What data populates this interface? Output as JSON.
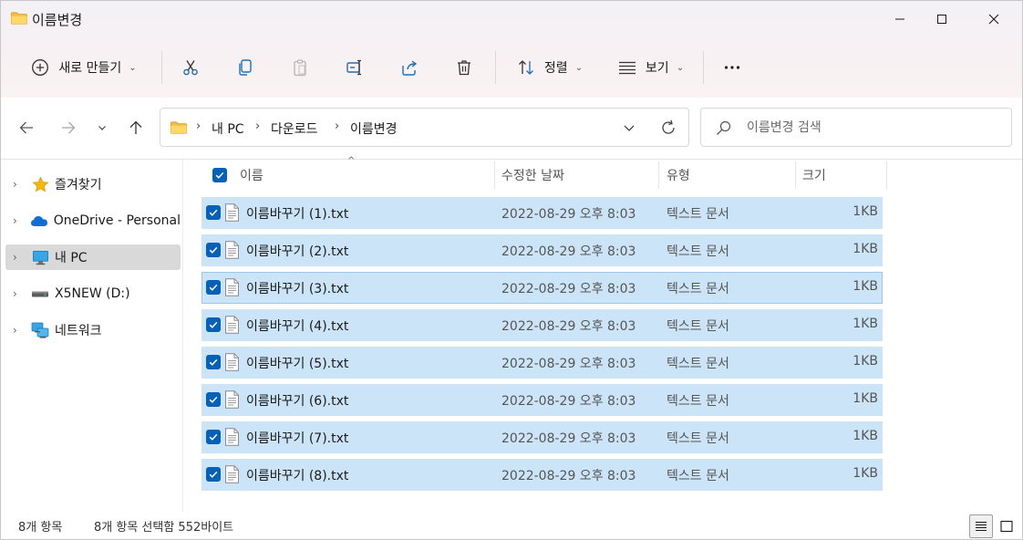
{
  "window": {
    "title": "이름변경",
    "controls": [
      "minimize",
      "maximize",
      "close"
    ]
  },
  "toolbar": {
    "new_label": "새로 만들기",
    "sort_label": "정렬",
    "view_label": "보기",
    "icons": [
      "cut-icon",
      "copy-icon",
      "paste-icon",
      "rename-icon",
      "share-icon",
      "delete-icon",
      "more-icon"
    ]
  },
  "nav": {
    "breadcrumbs": [
      "내 PC",
      "다운로드",
      "이름변경"
    ],
    "search_placeholder": "이름변경 검색"
  },
  "sidebar": {
    "items": [
      {
        "label": "즐겨찾기",
        "icon": "star-icon",
        "selected": false
      },
      {
        "label": "OneDrive - Personal",
        "icon": "cloud-icon",
        "selected": false
      },
      {
        "label": "내 PC",
        "icon": "computer-icon",
        "selected": true
      },
      {
        "label": "X5NEW (D:)",
        "icon": "drive-icon",
        "selected": false
      },
      {
        "label": "네트워크",
        "icon": "network-icon",
        "selected": false
      }
    ]
  },
  "columns": {
    "name": "이름",
    "date": "수정한 날짜",
    "type": "유형",
    "size": "크기"
  },
  "files": [
    {
      "name": "이름바꾸기 (1).txt",
      "date": "2022-08-29 오후 8:03",
      "type": "텍스트 문서",
      "size": "1KB",
      "checked": true
    },
    {
      "name": "이름바꾸기 (2).txt",
      "date": "2022-08-29 오후 8:03",
      "type": "텍스트 문서",
      "size": "1KB",
      "checked": true
    },
    {
      "name": "이름바꾸기 (3).txt",
      "date": "2022-08-29 오후 8:03",
      "type": "텍스트 문서",
      "size": "1KB",
      "checked": true
    },
    {
      "name": "이름바꾸기 (4).txt",
      "date": "2022-08-29 오후 8:03",
      "type": "텍스트 문서",
      "size": "1KB",
      "checked": true
    },
    {
      "name": "이름바꾸기 (5).txt",
      "date": "2022-08-29 오후 8:03",
      "type": "텍스트 문서",
      "size": "1KB",
      "checked": true
    },
    {
      "name": "이름바꾸기 (6).txt",
      "date": "2022-08-29 오후 8:03",
      "type": "텍스트 문서",
      "size": "1KB",
      "checked": true
    },
    {
      "name": "이름바꾸기 (7).txt",
      "date": "2022-08-29 오후 8:03",
      "type": "텍스트 문서",
      "size": "1KB",
      "checked": true
    },
    {
      "name": "이름바꾸기 (8).txt",
      "date": "2022-08-29 오후 8:03",
      "type": "텍스트 문서",
      "size": "1KB",
      "checked": true
    }
  ],
  "status": {
    "item_count": "8개 항목",
    "selection": "8개 항목 선택함 552바이트"
  },
  "colors": {
    "accent": "#0560b8",
    "selection": "#cce4f7",
    "folder": "#f8c24a"
  }
}
